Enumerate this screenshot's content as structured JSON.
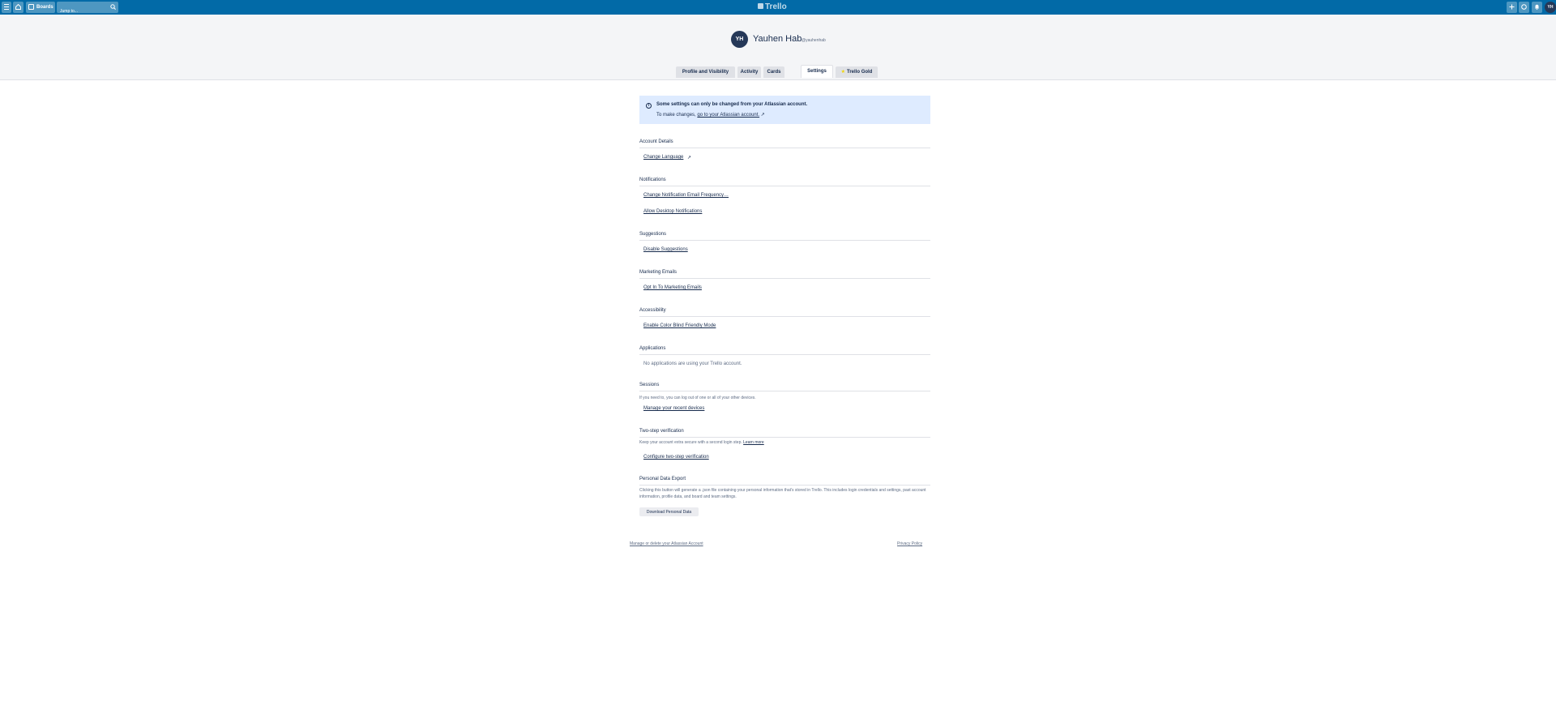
{
  "header": {
    "boards_label": "Boards",
    "search_placeholder": "Jump to...",
    "logo_text": "Trello",
    "avatar_initials": "YH"
  },
  "profile": {
    "initials": "YH",
    "full_name": "Yauhen Hab",
    "username": "@yauhenhab"
  },
  "tabs": [
    {
      "label": "Profile and Visibility"
    },
    {
      "label": "Activity"
    },
    {
      "label": "Cards"
    },
    {
      "label": "Settings",
      "active": true
    },
    {
      "label": "Trello Gold"
    }
  ],
  "banner": {
    "title": "Some settings can only be changed from your Atlassian account.",
    "body_prefix": "To make changes,",
    "link": "go to your Atlassian account.",
    "external_glyph": "↗"
  },
  "sections": {
    "account_details": {
      "title": "Account Details",
      "change_language": "Change Language",
      "external_glyph": "↗"
    },
    "notifications": {
      "title": "Notifications",
      "email_frequency": "Change Notification Email Frequency…",
      "desktop": "Allow Desktop Notifications"
    },
    "suggestions": {
      "title": "Suggestions",
      "disable": "Disable Suggestions"
    },
    "marketing": {
      "title": "Marketing Emails",
      "opt_in": "Opt In To Marketing Emails"
    },
    "accessibility": {
      "title": "Accessibility",
      "color_blind": "Enable Color Blind Friendly Mode"
    },
    "applications": {
      "title": "Applications",
      "empty": "No applications are using your Trello account."
    },
    "sessions": {
      "title": "Sessions",
      "description": "If you need to, you can log out of one or all of your other devices.",
      "manage": "Manage your recent devices"
    },
    "two_step": {
      "title": "Two-step verification",
      "description": "Keep your account extra secure with a second login step.",
      "learn_more": "Learn more",
      "configure": "Configure two-step verification"
    },
    "export": {
      "title": "Personal Data Export",
      "description": "Clicking this button will generate a .json file containing your personal information that's stored in Trello. This includes login credentials and settings, past account information, profile data, and board and team settings.",
      "button": "Download Personal Data"
    }
  },
  "footer": {
    "manage_account": "Manage or delete your Atlassian Account",
    "privacy": "Privacy Policy"
  },
  "colors": {
    "header_bg": "#026aa7",
    "banner_bg": "#deebff",
    "avatar_bg": "#253858",
    "gold_star": "#f2d600"
  }
}
